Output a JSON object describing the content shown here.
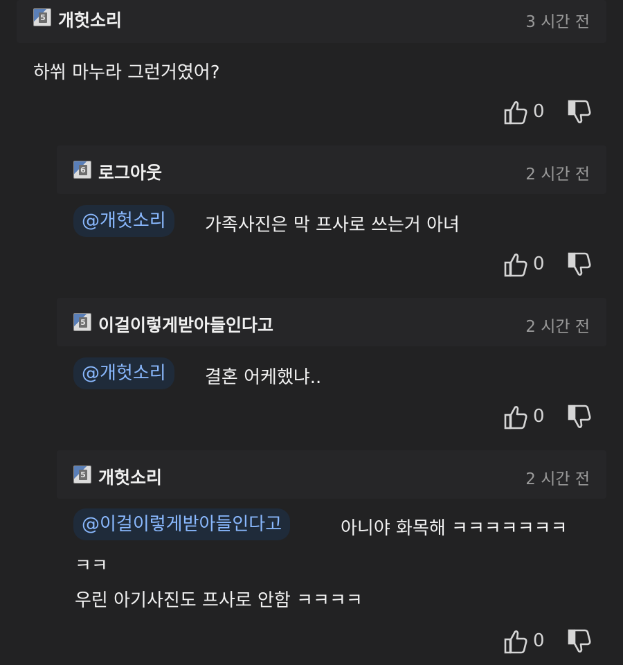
{
  "comments": [
    {
      "level": "5",
      "author": "개헛소리",
      "time": "3 시간 전",
      "text": "하쒸 마누라 그런거였어?",
      "votes": "0"
    },
    {
      "level": "6",
      "author": "로그아웃",
      "time": "2 시간 전",
      "mention": "@개헛소리",
      "text": "가족사진은 막 프사로 쓰는거 아녀",
      "votes": "0"
    },
    {
      "level": "5",
      "author": "이걸이렇게받아들인다고",
      "time": "2 시간 전",
      "mention": "@개헛소리",
      "text": "결혼 어케했냐..",
      "votes": "0"
    },
    {
      "level": "5",
      "author": "개헛소리",
      "time": "2 시간 전",
      "mention": "@이걸이렇게받아들인다고",
      "text_line1": "아니야 화목해 ㅋㅋㅋㅋㅋㅋㅋ",
      "text_line2": "ㅋㅋ",
      "text_line3": "우린 아기사진도 프사로 안함 ㅋㅋㅋㅋ",
      "votes": "0"
    }
  ],
  "icons": {
    "like": "thumbs-up-icon",
    "dislike": "thumbs-down-icon",
    "badge": "level-badge-icon"
  }
}
